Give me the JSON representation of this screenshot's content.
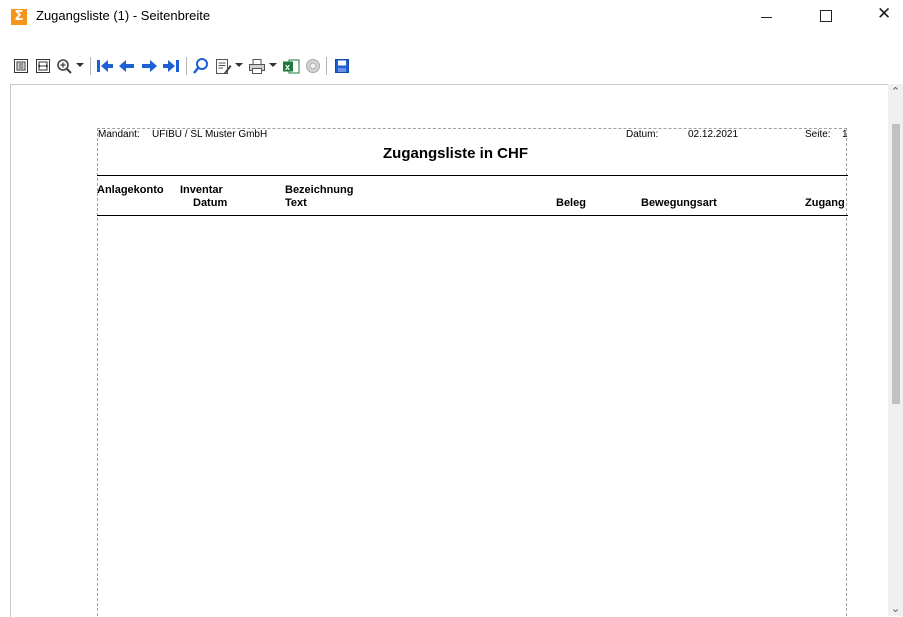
{
  "window": {
    "title": "Zugangsliste (1) - Seitenbreite",
    "app_icon_glyph": "Σ",
    "controls": {
      "minimize_icon": "minimize-icon",
      "maximize_icon": "maximize-icon",
      "close_icon": "close-icon"
    }
  },
  "toolbar": {
    "buttons": [
      "single-page-icon",
      "page-width-icon",
      "zoom-icon",
      "first-page-icon",
      "previous-page-icon",
      "next-page-icon",
      "last-page-icon",
      "search-icon",
      "edit-icon",
      "print-icon",
      "excel-export-icon",
      "stop-icon",
      "save-icon"
    ]
  },
  "report": {
    "mandant_label": "Mandant:",
    "mandant_value": "UFIBU  /  SL Muster GmbH",
    "datum_label": "Datum:",
    "datum_value": "02.12.2021",
    "seite_label": "Seite:",
    "seite_value": "1",
    "title": "Zugangsliste in CHF",
    "columns": {
      "anlagekonto": "Anlagekonto",
      "inventar": "Inventar",
      "datum": "Datum",
      "bezeichnung": "Bezeichnung",
      "text": "Text",
      "beleg": "Beleg",
      "bewegungsart": "Bewegungsart",
      "zugang": "Zugang"
    }
  },
  "colors": {
    "accent_blue": "#1e5fd6",
    "app_icon_orange": "#f7941d",
    "excel_green": "#1e7b3c"
  }
}
